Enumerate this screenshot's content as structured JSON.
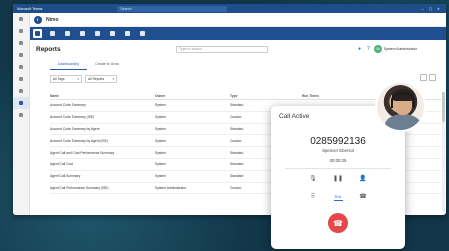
{
  "titlebar": {
    "app": "Microsoft Teams",
    "search": "Search"
  },
  "app": {
    "name": "Nimo"
  },
  "page": {
    "title": "Reports",
    "search_placeholder": "Type to search",
    "user": "System Administrator",
    "user_initials": "SA"
  },
  "tabs": [
    {
      "label": "Dashboard(s)"
    },
    {
      "label": "Create to Grow"
    }
  ],
  "filters": [
    {
      "label": "All Tags"
    },
    {
      "label": "All Reports"
    }
  ],
  "table": {
    "headers": [
      "Name",
      "Owner",
      "Type",
      "Run Times",
      "Last Run"
    ],
    "rows": [
      [
        "Account Code Summary",
        "System",
        "Standard",
        "",
        ""
      ],
      [
        "Account Code Summary (ISE)",
        "System",
        "Custom",
        "",
        ""
      ],
      [
        "Account Code Summary by Agent",
        "System",
        "Standard",
        "",
        ""
      ],
      [
        "Account Code Summary by Agent (ISE)",
        "System",
        "Custom",
        "",
        ""
      ],
      [
        "Agent Call and Chat Performance Summary",
        "System",
        "Standard",
        "",
        ""
      ],
      [
        "Agent Call Cost",
        "System",
        "Standard",
        "",
        ""
      ],
      [
        "Agent Call Summary",
        "System",
        "Standard",
        "",
        ""
      ],
      [
        "Agent Call Performance Summary (ISE)",
        "System Administrator",
        "Custom",
        "",
        ""
      ]
    ]
  },
  "call": {
    "title": "Call Active",
    "number": "0285992136",
    "name": "Spencer Ebersol",
    "duration": "00:00:25",
    "keypad_label": "R/A"
  },
  "colors": {
    "brand": "#1f4f8f",
    "hangup": "#e54848",
    "accent": "#2a6fd0"
  }
}
